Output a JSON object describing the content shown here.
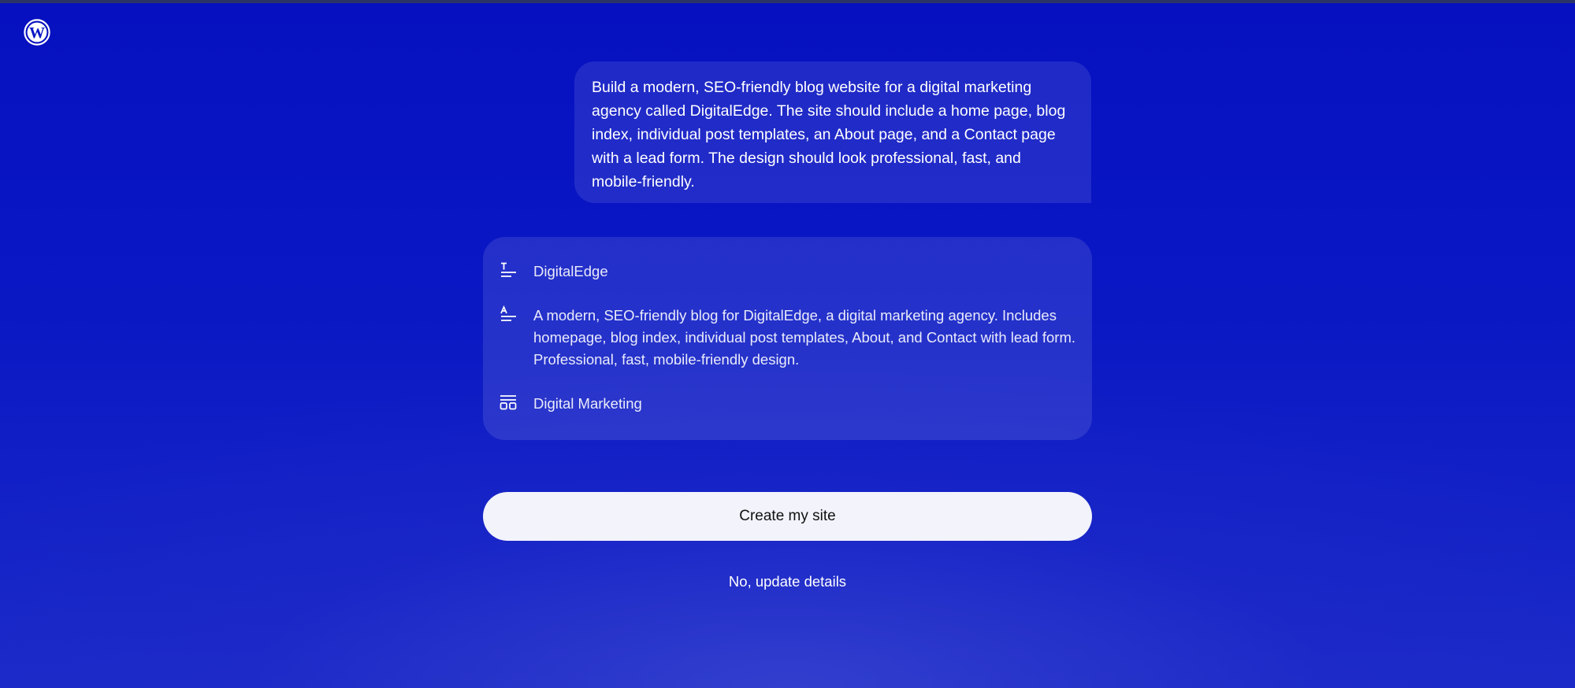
{
  "app": {
    "logo_icon": "wordpress-logo-icon"
  },
  "prompt": {
    "text": "Build a modern, SEO-friendly blog website for a digital marketing agency called DigitalEdge. The site should include a home page, blog index, individual post templates, an About page, and a Contact page with a lead form. The design should look professional, fast, and mobile-friendly."
  },
  "summary": {
    "site_name": {
      "icon": "title-icon",
      "value": "DigitalEdge"
    },
    "description": {
      "icon": "description-icon",
      "value": "A modern, SEO-friendly blog for DigitalEdge, a digital marketing agency. Includes homepage, blog index, individual post templates, About, and Contact with lead form. Professional, fast, mobile-friendly design."
    },
    "category": {
      "icon": "category-icon",
      "value": "Digital Marketing"
    }
  },
  "actions": {
    "create_label": "Create my site",
    "update_label": "No, update details"
  },
  "colors": {
    "background": "#0a16c4",
    "card": "rgba(255,255,255,0.11)",
    "button": "#f2f3fb"
  }
}
